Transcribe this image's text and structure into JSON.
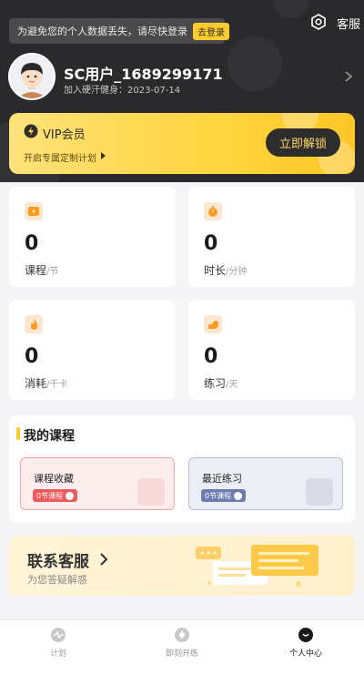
{
  "header": {
    "login_tip": "为避免您的个人数据丢失，请尽快登录",
    "login_button": "去登录",
    "service_label": "客服",
    "username": "SC用户_1689299171",
    "join_label": "加入硬汗健身：",
    "join_date": "2023-07-14"
  },
  "vip": {
    "title": "VIP会员",
    "subtitle": "开启专属定制计划",
    "unlock_button": "立即解锁"
  },
  "stats": [
    {
      "value": "0",
      "label": "课程",
      "unit": "/节",
      "icon": "video-icon"
    },
    {
      "value": "0",
      "label": "时长",
      "unit": "/分钟",
      "icon": "timer-icon"
    },
    {
      "value": "0",
      "label": "消耗",
      "unit": "/千卡",
      "icon": "flame-icon"
    },
    {
      "value": "0",
      "label": "练习",
      "unit": "/天",
      "icon": "muscle-icon"
    }
  ],
  "courses": {
    "title": "我的课程",
    "items": [
      {
        "name": "课程收藏",
        "badge": "0节课程",
        "color": "#f05a5a"
      },
      {
        "name": "最近练习",
        "badge": "0节课程",
        "color": "#6e7bb0"
      }
    ]
  },
  "contact": {
    "title": "联系客服",
    "subtitle": "为您答疑解惑"
  },
  "tabbar": {
    "items": [
      {
        "label": "计划",
        "icon": "heartbeat-icon"
      },
      {
        "label": "即刻开练",
        "icon": "dumbbell-icon"
      },
      {
        "label": "个人中心",
        "icon": "profile-icon"
      }
    ],
    "active": "个人中心"
  },
  "colors": {
    "header_bg": "#2a2a2c",
    "accent_yellow": "#ffcb2f",
    "favorite_red": "#f05a5a",
    "recent_blue": "#6e7bb0"
  }
}
